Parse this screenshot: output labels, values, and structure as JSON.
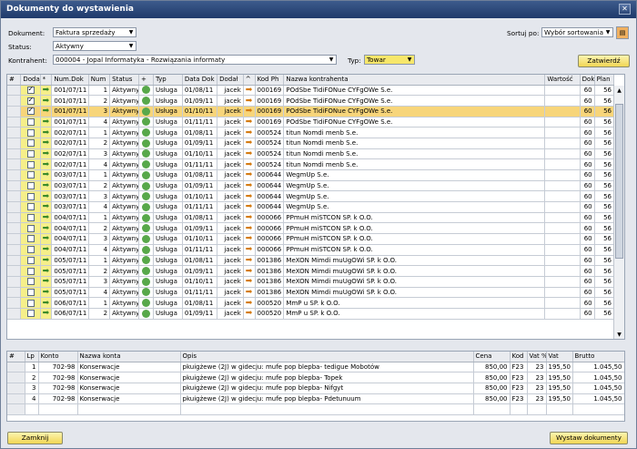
{
  "window": {
    "title": "Dokumenty do wystawienia"
  },
  "filters": {
    "dokument_label": "Dokument:",
    "dokument_value": "Faktura sprzedaży",
    "status_label": "Status:",
    "status_value": "Aktywny",
    "kontrahent_label": "Kontrahent:",
    "kontrahent_value": "000004 - Jopal Informatyka - Rozwiązania informaty",
    "typ_label": "Typ:",
    "typ_value": "Towar",
    "sortuj_label": "Sortuj po:",
    "sortuj_value": "Wybór sortowania",
    "zatwierdz": "Zatwierdź"
  },
  "grid": {
    "headers": [
      "#",
      "Dodaj",
      "*",
      "Num.Dok",
      "Num",
      "Status",
      "+",
      "Typ",
      "Data Dok",
      "Dodał",
      "^",
      "Kod Ph",
      "Nazwa kontrahenta",
      "Wartość",
      "Dok",
      "Plan"
    ],
    "rows": [
      {
        "check": true,
        "num_dok": "001/07/11",
        "num": "1",
        "status": "Aktywny",
        "typ": "Usługa",
        "data": "01/08/11",
        "dodal": "jacek",
        "kod": "000169",
        "nazwa": "POdSbe TidiFONue CYFgOWe S.e.",
        "dok": "60",
        "plan": "56",
        "hl": false
      },
      {
        "check": true,
        "num_dok": "001/07/11",
        "num": "2",
        "status": "Aktywny",
        "typ": "Usługa",
        "data": "01/09/11",
        "dodal": "jacek",
        "kod": "000169",
        "nazwa": "POdSbe TidiFONue CYFgOWe S.e.",
        "dok": "60",
        "plan": "56",
        "hl": false
      },
      {
        "check": true,
        "num_dok": "001/07/11",
        "num": "3",
        "status": "Aktywny",
        "typ": "Usługa",
        "data": "01/10/11",
        "dodal": "jacek",
        "kod": "000169",
        "nazwa": "POdSbe TidiFONue CYFgOWe S.e.",
        "dok": "60",
        "plan": "56",
        "hl": true
      },
      {
        "check": false,
        "num_dok": "001/07/11",
        "num": "4",
        "status": "Aktywny",
        "typ": "Usługa",
        "data": "01/11/11",
        "dodal": "jacek",
        "kod": "000169",
        "nazwa": "POdSbe TidiFONue CYFgOWe S.e.",
        "dok": "60",
        "plan": "56",
        "hl": false
      },
      {
        "check": false,
        "num_dok": "002/07/11",
        "num": "1",
        "status": "Aktywny",
        "typ": "Usługa",
        "data": "01/08/11",
        "dodal": "jacek",
        "kod": "000524",
        "nazwa": "titun Nomdi menb S.e.",
        "dok": "60",
        "plan": "56",
        "hl": false
      },
      {
        "check": false,
        "num_dok": "002/07/11",
        "num": "2",
        "status": "Aktywny",
        "typ": "Usługa",
        "data": "01/09/11",
        "dodal": "jacek",
        "kod": "000524",
        "nazwa": "titun Nomdi menb S.e.",
        "dok": "60",
        "plan": "56",
        "hl": false
      },
      {
        "check": false,
        "num_dok": "002/07/11",
        "num": "3",
        "status": "Aktywny",
        "typ": "Usługa",
        "data": "01/10/11",
        "dodal": "jacek",
        "kod": "000524",
        "nazwa": "titun Nomdi menb S.e.",
        "dok": "60",
        "plan": "56",
        "hl": false
      },
      {
        "check": false,
        "num_dok": "002/07/11",
        "num": "4",
        "status": "Aktywny",
        "typ": "Usługa",
        "data": "01/11/11",
        "dodal": "jacek",
        "kod": "000524",
        "nazwa": "titun Nomdi menb S.e.",
        "dok": "60",
        "plan": "56",
        "hl": false
      },
      {
        "check": false,
        "num_dok": "003/07/11",
        "num": "1",
        "status": "Aktywny",
        "typ": "Usługa",
        "data": "01/08/11",
        "dodal": "jacek",
        "kod": "000644",
        "nazwa": "WegmUp S.e.",
        "dok": "60",
        "plan": "56",
        "hl": false
      },
      {
        "check": false,
        "num_dok": "003/07/11",
        "num": "2",
        "status": "Aktywny",
        "typ": "Usługa",
        "data": "01/09/11",
        "dodal": "jacek",
        "kod": "000644",
        "nazwa": "WegmUp S.e.",
        "dok": "60",
        "plan": "56",
        "hl": false
      },
      {
        "check": false,
        "num_dok": "003/07/11",
        "num": "3",
        "status": "Aktywny",
        "typ": "Usługa",
        "data": "01/10/11",
        "dodal": "jacek",
        "kod": "000644",
        "nazwa": "WegmUp S.e.",
        "dok": "60",
        "plan": "56",
        "hl": false
      },
      {
        "check": false,
        "num_dok": "003/07/11",
        "num": "4",
        "status": "Aktywny",
        "typ": "Usługa",
        "data": "01/11/11",
        "dodal": "jacek",
        "kod": "000644",
        "nazwa": "WegmUp S.e.",
        "dok": "60",
        "plan": "56",
        "hl": false
      },
      {
        "check": false,
        "num_dok": "004/07/11",
        "num": "1",
        "status": "Aktywny",
        "typ": "Usługa",
        "data": "01/08/11",
        "dodal": "jacek",
        "kod": "000066",
        "nazwa": "PPmuH miSTCON SP. k O.O.",
        "dok": "60",
        "plan": "56",
        "hl": false
      },
      {
        "check": false,
        "num_dok": "004/07/11",
        "num": "2",
        "status": "Aktywny",
        "typ": "Usługa",
        "data": "01/09/11",
        "dodal": "jacek",
        "kod": "000066",
        "nazwa": "PPmuH miSTCON SP. k O.O.",
        "dok": "60",
        "plan": "56",
        "hl": false
      },
      {
        "check": false,
        "num_dok": "004/07/11",
        "num": "3",
        "status": "Aktywny",
        "typ": "Usługa",
        "data": "01/10/11",
        "dodal": "jacek",
        "kod": "000066",
        "nazwa": "PPmuH miSTCON SP. k O.O.",
        "dok": "60",
        "plan": "56",
        "hl": false
      },
      {
        "check": false,
        "num_dok": "004/07/11",
        "num": "4",
        "status": "Aktywny",
        "typ": "Usługa",
        "data": "01/11/11",
        "dodal": "jacek",
        "kod": "000066",
        "nazwa": "PPmuH miSTCON SP. k O.O.",
        "dok": "60",
        "plan": "56",
        "hl": false
      },
      {
        "check": false,
        "num_dok": "005/07/11",
        "num": "1",
        "status": "Aktywny",
        "typ": "Usługa",
        "data": "01/08/11",
        "dodal": "jacek",
        "kod": "001386",
        "nazwa": "MeXON Mimdi muUgOWi SP. k O.O.",
        "dok": "60",
        "plan": "56",
        "hl": false
      },
      {
        "check": false,
        "num_dok": "005/07/11",
        "num": "2",
        "status": "Aktywny",
        "typ": "Usługa",
        "data": "01/09/11",
        "dodal": "jacek",
        "kod": "001386",
        "nazwa": "MeXON Mimdi muUgOWi SP. k O.O.",
        "dok": "60",
        "plan": "56",
        "hl": false
      },
      {
        "check": false,
        "num_dok": "005/07/11",
        "num": "3",
        "status": "Aktywny",
        "typ": "Usługa",
        "data": "01/10/11",
        "dodal": "jacek",
        "kod": "001386",
        "nazwa": "MeXON Mimdi muUgOWi SP. k O.O.",
        "dok": "60",
        "plan": "56",
        "hl": false
      },
      {
        "check": false,
        "num_dok": "005/07/11",
        "num": "4",
        "status": "Aktywny",
        "typ": "Usługa",
        "data": "01/11/11",
        "dodal": "jacek",
        "kod": "001386",
        "nazwa": "MeXON Mimdi muUgOWi SP. k O.O.",
        "dok": "60",
        "plan": "56",
        "hl": false
      },
      {
        "check": false,
        "num_dok": "006/07/11",
        "num": "1",
        "status": "Aktywny",
        "typ": "Usługa",
        "data": "01/08/11",
        "dodal": "jacek",
        "kod": "000520",
        "nazwa": "MmP u SP. k O.O.",
        "dok": "60",
        "plan": "56",
        "hl": false
      },
      {
        "check": false,
        "num_dok": "006/07/11",
        "num": "2",
        "status": "Aktywny",
        "typ": "Usługa",
        "data": "01/09/11",
        "dodal": "jacek",
        "kod": "000520",
        "nazwa": "MmP u SP. k O.O.",
        "dok": "60",
        "plan": "56",
        "hl": false
      }
    ]
  },
  "lines": {
    "headers": [
      "#",
      "Lp",
      "Konto",
      "Nazwa konta",
      "Opis",
      "Cena",
      "Kod",
      "Vat %",
      "Vat",
      "Brutto"
    ],
    "rows": [
      {
        "lp": "1",
        "konto": "702-98",
        "nazwa": "Konserwacje",
        "opis": "pkuigżewe (2J) w gidecju: mufe pop blepba- tedigue Mobotów",
        "cena": "850,00",
        "kod": "F23",
        "vatp": "23",
        "vat": "195,50",
        "brutto": "1.045,50"
      },
      {
        "lp": "2",
        "konto": "702-98",
        "nazwa": "Konserwacje",
        "opis": "pkuigżewe (2J) w gidecju: mufe pop blepba- Topek",
        "cena": "850,00",
        "kod": "F23",
        "vatp": "23",
        "vat": "195,50",
        "brutto": "1.045,50"
      },
      {
        "lp": "3",
        "konto": "702-98",
        "nazwa": "Konserwacje",
        "opis": "pkuigżewe (2J) w gidecju: mufe pop blepba- Nifgyt",
        "cena": "850,00",
        "kod": "F23",
        "vatp": "23",
        "vat": "195,50",
        "brutto": "1.045,50"
      },
      {
        "lp": "4",
        "konto": "702-98",
        "nazwa": "Konserwacje",
        "opis": "pkuigżewe (2J) w gidecju: mufe pop blepba- Pdetunuum",
        "cena": "850,00",
        "kod": "F23",
        "vatp": "23",
        "vat": "195,50",
        "brutto": "1.045,50"
      }
    ]
  },
  "footer": {
    "zamknij": "Zamknij",
    "wystaw": "Wystaw dokumenty"
  }
}
